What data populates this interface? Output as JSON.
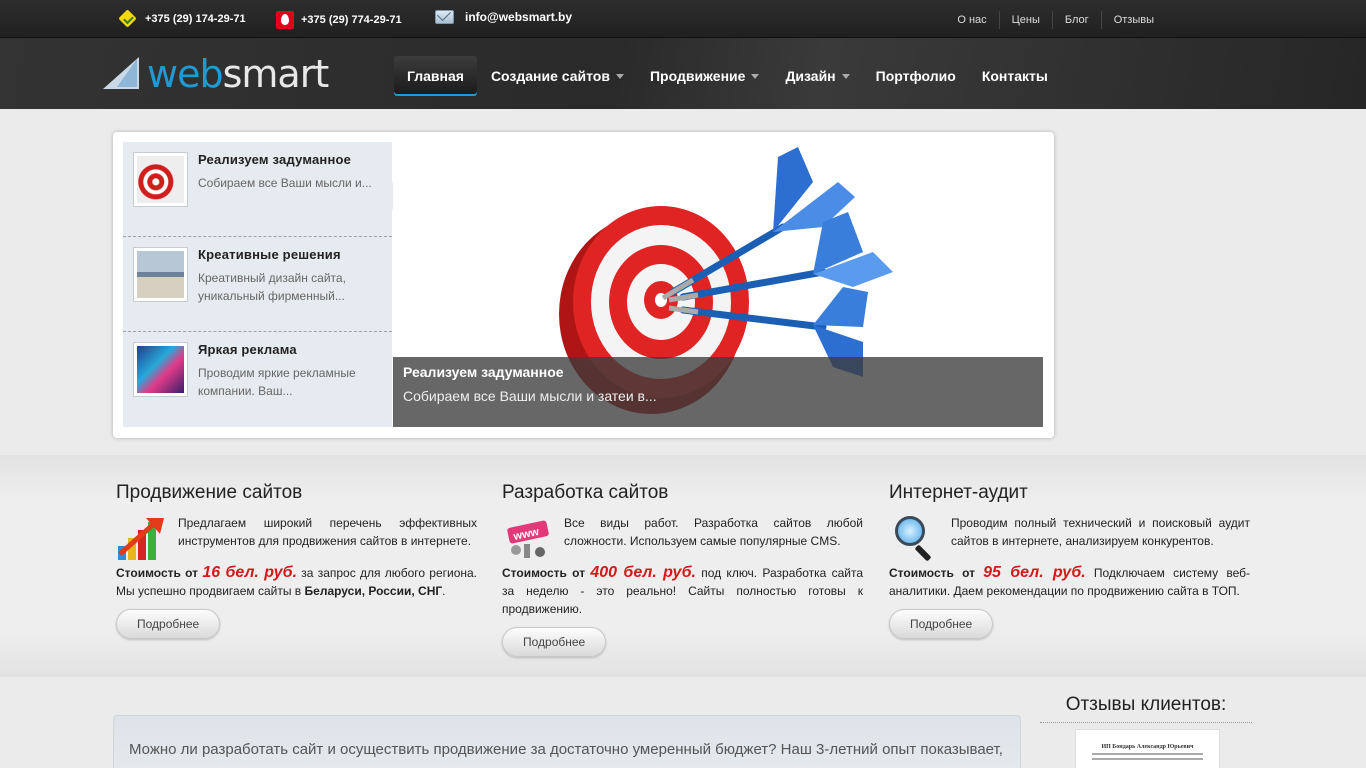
{
  "topbar": {
    "phone_velcom": "+375 (29) 174-29-71",
    "phone_mts": "+375 (29) 774-29-71",
    "email": "info@websmart.by",
    "links": [
      "О нас",
      "Цены",
      "Блог",
      "Отзывы"
    ]
  },
  "logo": {
    "part1": "web",
    "part2": "smart"
  },
  "nav": [
    {
      "label": "Главная"
    },
    {
      "label": "Создание сайтов"
    },
    {
      "label": "Продвижение"
    },
    {
      "label": "Дизайн"
    },
    {
      "label": "Портфолио"
    },
    {
      "label": "Контакты"
    }
  ],
  "slider": {
    "items": [
      {
        "title": "Реализуем задуманное",
        "desc": "Собираем все Ваши мысли и..."
      },
      {
        "title": "Креативные решения",
        "desc": "Креативный дизайн сайта, уникальный фирменный..."
      },
      {
        "title": "Яркая реклама",
        "desc": "Проводим яркие рекламные компании. Ваш..."
      }
    ],
    "caption_title": "Реализуем задуманное",
    "caption_text": "Собираем все Ваши мысли и затеи в..."
  },
  "services": [
    {
      "title": "Продвижение сайтов",
      "text": "Предлагаем широкий перечень эффективных инструментов для продвижения сайтов в интернете.",
      "price_prefix": "Стоимость от",
      "price": "16",
      "price_unit": "бел. руб.",
      "price_suffix": "за запрос для любого региона. Мы успешно продвигаем сайты в",
      "price_bold_tail": "Беларуси, России, СНГ",
      "button": "Подробнее"
    },
    {
      "title": "Разработка сайтов",
      "text": "Все виды работ. Разработка сайтов любой сложности. Используем самые популярные CMS.",
      "price_prefix": "Стоимость от",
      "price": "400",
      "price_unit": "бел. руб.",
      "price_suffix": "под ключ. Разработка сайта за неделю - это реально! Сайты полностью готовы к продвижению.",
      "button": "Подробнее"
    },
    {
      "title": "Интернет-аудит",
      "text": "Проводим полный технический и поисковый аудит сайтов в интернете, анализируем конкурентов.",
      "price_prefix": "Стоимость от",
      "price": "95",
      "price_unit": "бел. руб.",
      "price_suffix": "Подключаем систему веб-аналитики. Даем рекомендации по продвижению сайта в ТОП.",
      "button": "Подробнее"
    }
  ],
  "about": {
    "text": "Можно ли разработать сайт и осуществить продвижение за достаточно умеренный бюджет? Наш 3-летний опыт показывает,"
  },
  "reviews": {
    "title": "Отзывы клиентов:",
    "doc_heading": "ИП Бондарь Александр Юрьевич"
  },
  "colors": {
    "accent": "#1e9ad6",
    "price": "#d31a1a",
    "header_bg": "#2b2b2b"
  }
}
